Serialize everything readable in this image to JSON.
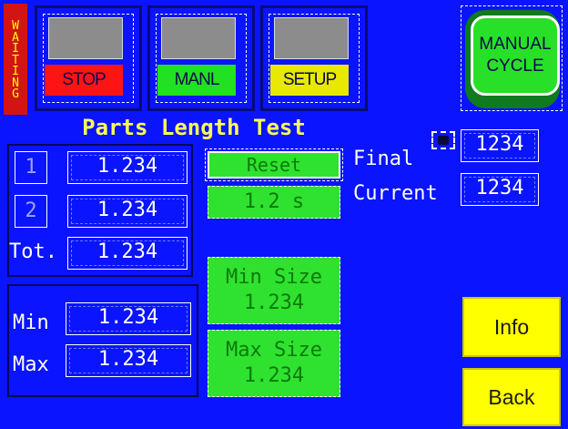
{
  "status": {
    "waiting_label": "WAITING",
    "color": "#d21414"
  },
  "top_buttons": {
    "stop": {
      "label": "STOP",
      "color": "#ff1414"
    },
    "manl": {
      "label": "MANL",
      "color": "#22e022"
    },
    "setup": {
      "label": "SETUP",
      "color": "#e8e800"
    }
  },
  "manual_cycle": {
    "line1": "MANUAL",
    "line2": "CYCLE"
  },
  "title": "Parts Length Test",
  "readings": {
    "rows": [
      {
        "index": "1",
        "value": "1.234"
      },
      {
        "index": "2",
        "value": "1.234"
      }
    ],
    "total_label": "Tot.",
    "total_value": "1.234"
  },
  "limits": {
    "min_label": "Min",
    "min_value": "1.234",
    "max_label": "Max",
    "max_value": "1.234"
  },
  "timer": {
    "reset_label": "Reset",
    "value": "1.2",
    "unit": "s"
  },
  "size_buttons": {
    "min": {
      "label": "Min Size",
      "value": "1.234"
    },
    "max": {
      "label": "Max Size",
      "value": "1.234"
    }
  },
  "counts": {
    "final_label": "Final",
    "final_value": "1234",
    "current_label": "Current",
    "current_value": "1234"
  },
  "nav": {
    "info_label": "Info",
    "back_label": "Back"
  },
  "icons": {
    "final_indicator": "indicator-lamp-icon"
  }
}
